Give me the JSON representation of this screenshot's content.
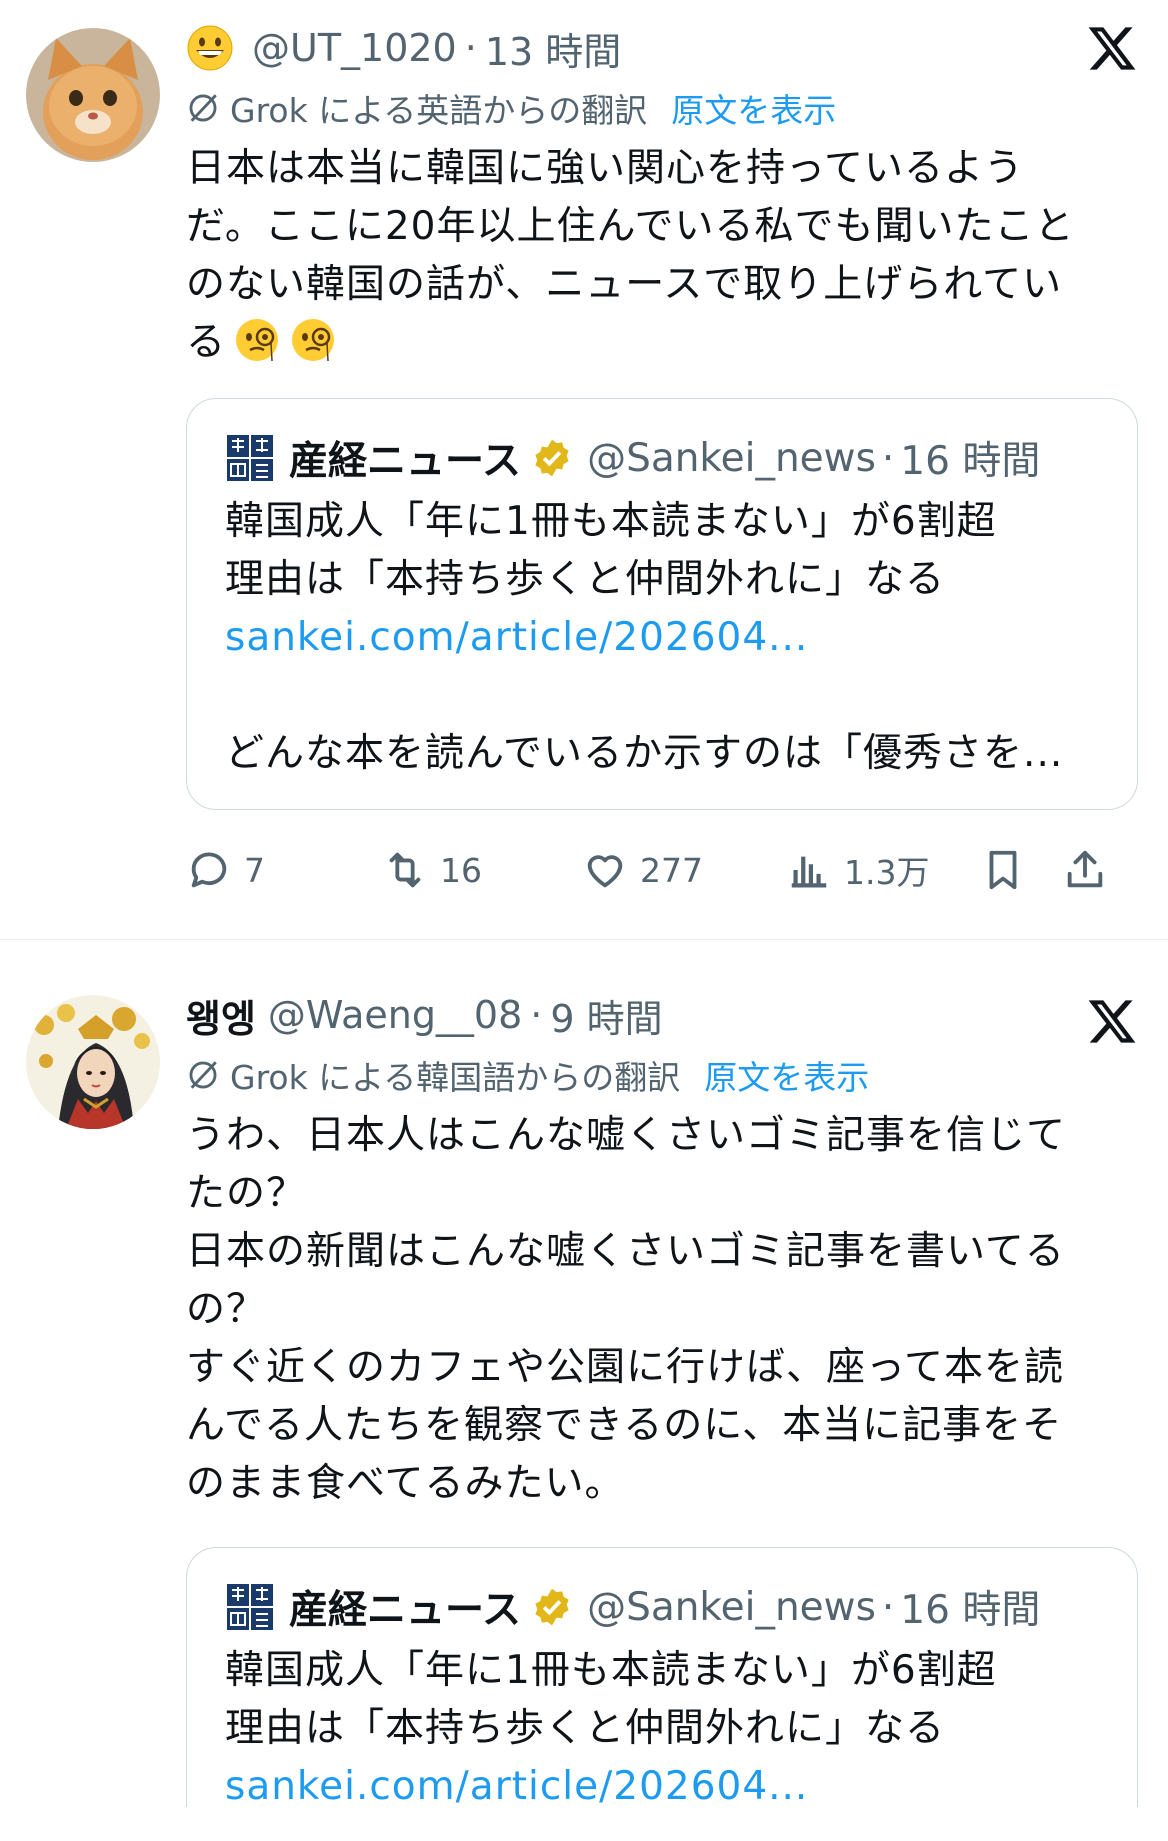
{
  "tweets": [
    {
      "name": "",
      "handle": "@UT_1020",
      "time": "13 時間",
      "translation_note": "Grok による英語からの翻訳",
      "show_original": "原文を表示",
      "body": [
        "日本は本当に韓国に強い関心を持っているよう",
        "だ。ここに20年以上住んでいる私でも聞いたこと",
        "のない韓国の話が、ニュースで取り上げられてい",
        "る"
      ],
      "quote": {
        "name": "産経ニュース",
        "handle": "@Sankei_news",
        "time": "16 時間",
        "lines": [
          "韓国成人「年に1冊も本読まない」が6割超",
          "理由は「本持ち歩くと仲間外れに」なる"
        ],
        "link": "sankei.com/article/202604...",
        "extra": "どんな本を読んでいるか示すのは「優秀さを..."
      },
      "actions": {
        "replies": "7",
        "reposts": "16",
        "likes": "277",
        "views": "1.3万"
      }
    },
    {
      "name": "왱엥",
      "handle": "@Waeng__08",
      "time": "9 時間",
      "translation_note": "Grok による韓国語からの翻訳",
      "show_original": "原文を表示",
      "body": [
        "うわ、日本人はこんな嘘くさいゴミ記事を信じて",
        "たの？",
        "日本の新聞はこんな嘘くさいゴミ記事を書いてる",
        "の？",
        "すぐ近くのカフェや公園に行けば、座って本を読",
        "んでる人たちを観察できるのに、本当に記事をそ",
        "のまま食べてるみたい。"
      ],
      "quote": {
        "name": "産経ニュース",
        "handle": "@Sankei_news",
        "time": "16 時間",
        "lines": [
          "韓国成人「年に1冊も本読まない」が6割超",
          "理由は「本持ち歩くと仲間外れに」なる"
        ],
        "link": "sankei.com/article/202604..."
      }
    }
  ],
  "colors": {
    "accent": "#1d9bf0",
    "secondary_text": "#536471",
    "verified_gold": "#e2b719",
    "border": "#cfd9de"
  }
}
